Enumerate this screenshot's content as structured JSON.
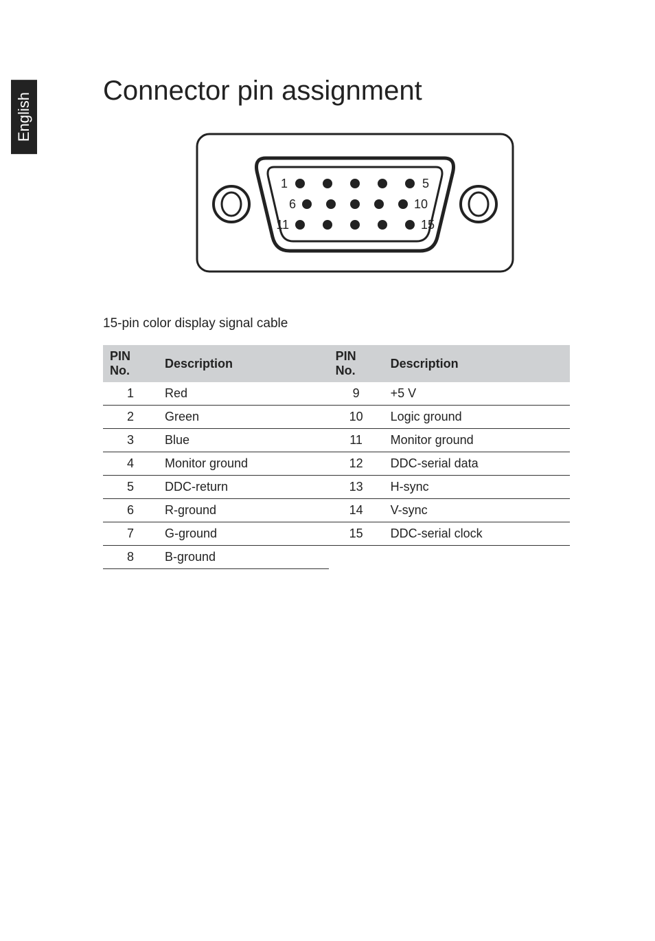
{
  "side_tab": "English",
  "title": "Connector pin assignment",
  "subhead": "15-pin color display signal cable",
  "diagram": {
    "pin_labels": [
      "1",
      "5",
      "6",
      "10",
      "11",
      "15"
    ]
  },
  "table": {
    "headers": {
      "pin": "PIN No.",
      "desc": "Description"
    },
    "rows": [
      {
        "l_no": "1",
        "l_desc": "Red",
        "r_no": "9",
        "r_desc": "+5 V"
      },
      {
        "l_no": "2",
        "l_desc": "Green",
        "r_no": "10",
        "r_desc": "Logic ground"
      },
      {
        "l_no": "3",
        "l_desc": "Blue",
        "r_no": "11",
        "r_desc": "Monitor ground"
      },
      {
        "l_no": "4",
        "l_desc": "Monitor ground",
        "r_no": "12",
        "r_desc": "DDC-serial data"
      },
      {
        "l_no": "5",
        "l_desc": "DDC-return",
        "r_no": "13",
        "r_desc": "H-sync"
      },
      {
        "l_no": "6",
        "l_desc": "R-ground",
        "r_no": "14",
        "r_desc": "V-sync"
      },
      {
        "l_no": "7",
        "l_desc": "G-ground",
        "r_no": "15",
        "r_desc": "DDC-serial clock"
      },
      {
        "l_no": "8",
        "l_desc": "B-ground",
        "r_no": "",
        "r_desc": ""
      }
    ]
  }
}
